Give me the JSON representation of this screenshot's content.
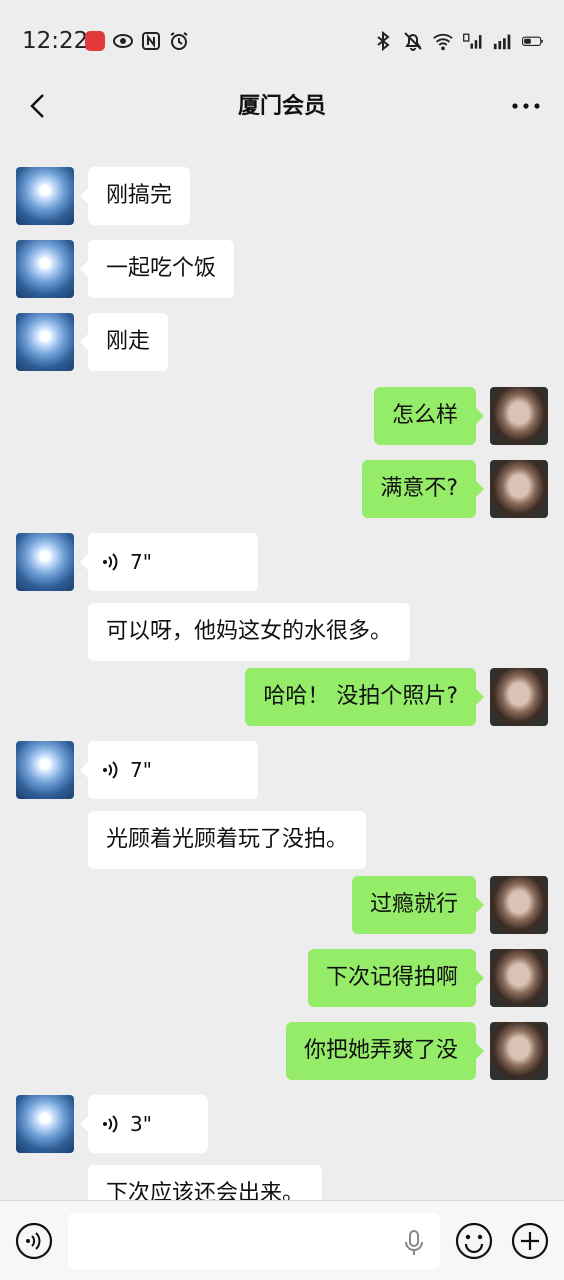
{
  "status_bar": {
    "time": "12:22",
    "left_icons": [
      "huawei-app-icon",
      "eye-icon",
      "nfc-icon",
      "alarm-icon"
    ],
    "right_icons": [
      "bluetooth-icon",
      "mute-icon",
      "wifi-icon",
      "signal-4g-icon",
      "signal-icon",
      "battery-icon"
    ]
  },
  "header": {
    "title": "厦门会员"
  },
  "messages": [
    {
      "side": "left",
      "bubbles": [
        {
          "type": "text",
          "text": "刚搞完"
        }
      ]
    },
    {
      "side": "left",
      "bubbles": [
        {
          "type": "text",
          "text": "一起吃个饭"
        }
      ]
    },
    {
      "side": "left",
      "bubbles": [
        {
          "type": "text",
          "text": "刚走"
        }
      ]
    },
    {
      "side": "right",
      "bubbles": [
        {
          "type": "text",
          "text": "怎么样"
        }
      ]
    },
    {
      "side": "right",
      "bubbles": [
        {
          "type": "text",
          "text": "满意不?"
        }
      ]
    },
    {
      "side": "left",
      "bubbles": [
        {
          "type": "voice",
          "duration": "7\""
        },
        {
          "type": "text",
          "text": "可以呀，他妈这女的水很多。"
        }
      ]
    },
    {
      "side": "right",
      "bubbles": [
        {
          "type": "text",
          "text": "哈哈！ 没拍个照片?"
        }
      ]
    },
    {
      "side": "left",
      "bubbles": [
        {
          "type": "voice",
          "duration": "7\""
        },
        {
          "type": "text",
          "text": "光顾着光顾着玩了没拍。"
        }
      ]
    },
    {
      "side": "right",
      "bubbles": [
        {
          "type": "text",
          "text": "过瘾就行"
        }
      ]
    },
    {
      "side": "right",
      "bubbles": [
        {
          "type": "text",
          "text": "下次记得拍啊"
        }
      ]
    },
    {
      "side": "right",
      "bubbles": [
        {
          "type": "text",
          "text": "你把她弄爽了没"
        }
      ]
    },
    {
      "side": "left",
      "bubbles": [
        {
          "type": "voice",
          "duration": "3\""
        },
        {
          "type": "text",
          "text": "下次应该还会出来。"
        }
      ]
    }
  ],
  "input_bar": {
    "placeholder": ""
  },
  "colors": {
    "background": "#ededed",
    "bubble_self": "#95ec69",
    "bubble_other": "#ffffff",
    "input_bar": "#f7f7f7"
  }
}
